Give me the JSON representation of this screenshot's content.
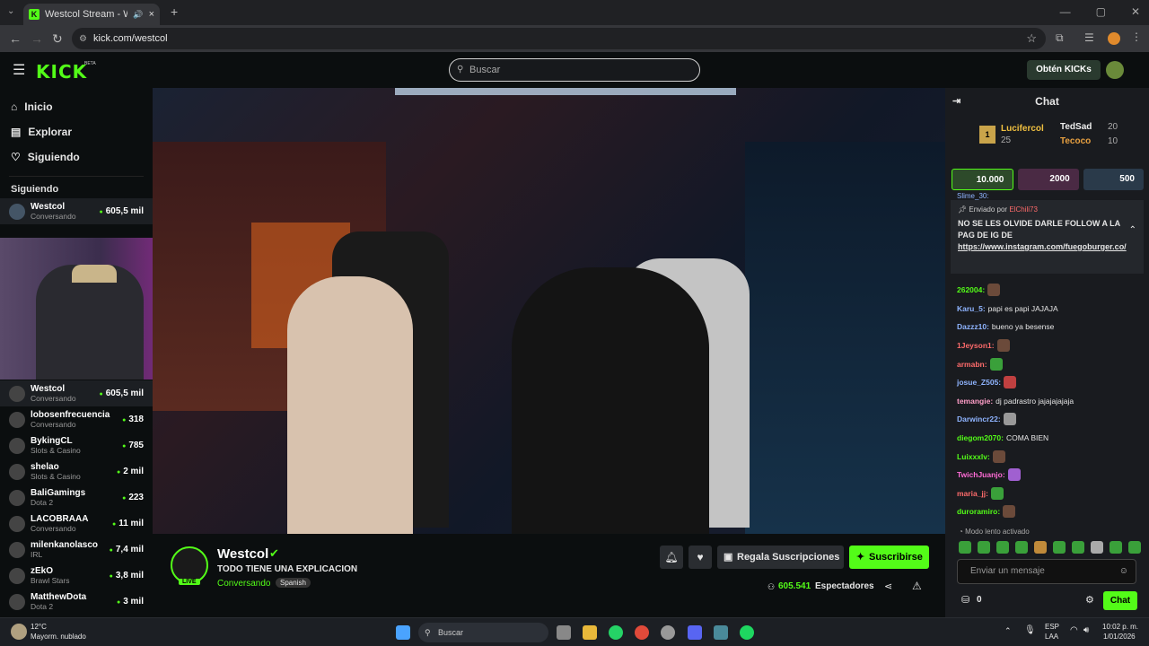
{
  "browser": {
    "tab_title": "Westcol Stream - Watch Li",
    "url": "kick.com/westcol",
    "tab_close": "×",
    "new_tab": "+"
  },
  "header": {
    "logo": "KICK",
    "beta": "BETA",
    "search_placeholder": "Buscar",
    "kicks_button": "Obtén KICKs"
  },
  "sidebar": {
    "nav": [
      "Inicio",
      "Explorar",
      "Siguiendo"
    ],
    "section": "Siguiendo",
    "top_channel": {
      "name": "Westcol",
      "category": "Conversando",
      "viewers": "605,5 mil"
    },
    "channels": [
      {
        "name": "Westcol",
        "category": "Conversando",
        "viewers": "605,5 mil"
      },
      {
        "name": "lobosenfrecuencia",
        "category": "Conversando",
        "viewers": "318"
      },
      {
        "name": "BykingCL",
        "category": "Slots & Casino",
        "viewers": "785"
      },
      {
        "name": "shelao",
        "category": "Slots & Casino",
        "viewers": "2 mil"
      },
      {
        "name": "BaliGamings",
        "category": "Dota 2",
        "viewers": "223"
      },
      {
        "name": "LACOBRAAA",
        "category": "Conversando",
        "viewers": "11 mil"
      },
      {
        "name": "milenkanolasco",
        "category": "IRL",
        "viewers": "7,4 mil"
      },
      {
        "name": "zEkO",
        "category": "Brawl Stars",
        "viewers": "3,8 mil"
      },
      {
        "name": "MatthewDota",
        "category": "Dota 2",
        "viewers": "3 mil"
      }
    ]
  },
  "stream": {
    "streamer": "Westcol",
    "title": "TODO TIENE UNA EXPLICACION",
    "category": "Conversando",
    "language": "Spanish",
    "live_badge": "LIVE",
    "gift_button": "Regala Suscripciones",
    "subscribe_button": "Suscribirse",
    "viewers": "605.541",
    "viewers_label": "Espectadores"
  },
  "chat": {
    "title": "Chat",
    "top_gifters": [
      {
        "name": "Lucifercol",
        "count": "25"
      },
      {
        "name": "TedSad",
        "count": "20"
      },
      {
        "name": "Tecoco",
        "count": "10"
      }
    ],
    "leaderboard": [
      "10.000",
      "2000",
      "500"
    ],
    "pinned": {
      "by_label": "Enviado por",
      "by_user": "ElChili73",
      "text": "NO SE LES OLVIDE DARLE FOLLOW A LA PAG DE IG DE",
      "link": "https://www.instagram.com/fuegoburger.co/",
      "above": "Slime_30:"
    },
    "messages": [
      {
        "user": "262004:",
        "text": "",
        "color": "#53fc18"
      },
      {
        "user": "Karu_5:",
        "text": "papi es papi JAJAJA",
        "color": "#8fb4ff"
      },
      {
        "user": "Dazzz10:",
        "text": "bueno ya besense",
        "color": "#8fb4ff"
      },
      {
        "user": "1Jeyson1:",
        "text": "",
        "color": "#ff6b6b"
      },
      {
        "user": "armabn:",
        "text": "",
        "color": "#ff6b6b"
      },
      {
        "user": "josue_Z505:",
        "text": "",
        "color": "#8fb4ff"
      },
      {
        "user": "temangie:",
        "text": "dj padrastro jajajajajaja",
        "color": "#ff9ec8"
      },
      {
        "user": "Darwincr22:",
        "text": "",
        "color": "#8fb4ff"
      },
      {
        "user": "diegom2070:",
        "text": "COMA BIEN",
        "color": "#53fc18"
      },
      {
        "user": "Luixxxlv:",
        "text": "",
        "color": "#53fc18"
      },
      {
        "user": "TwichJuanjo:",
        "text": "",
        "color": "#ff6bd5"
      },
      {
        "user": "maria_jj:",
        "text": "",
        "color": "#ff6b6b"
      },
      {
        "user": "duroramiro:",
        "text": "",
        "color": "#53fc18"
      }
    ],
    "slow_mode": "Modo lento activado",
    "input_placeholder": "Enviar un mensaje",
    "points": "0",
    "send_button": "Chat"
  },
  "taskbar": {
    "temp": "12°C",
    "weather": "Mayorm. nublado",
    "search": "Buscar",
    "lang1": "ESP",
    "lang2": "LAA",
    "time": "10:02 p. m.",
    "date": "1/01/2026"
  }
}
